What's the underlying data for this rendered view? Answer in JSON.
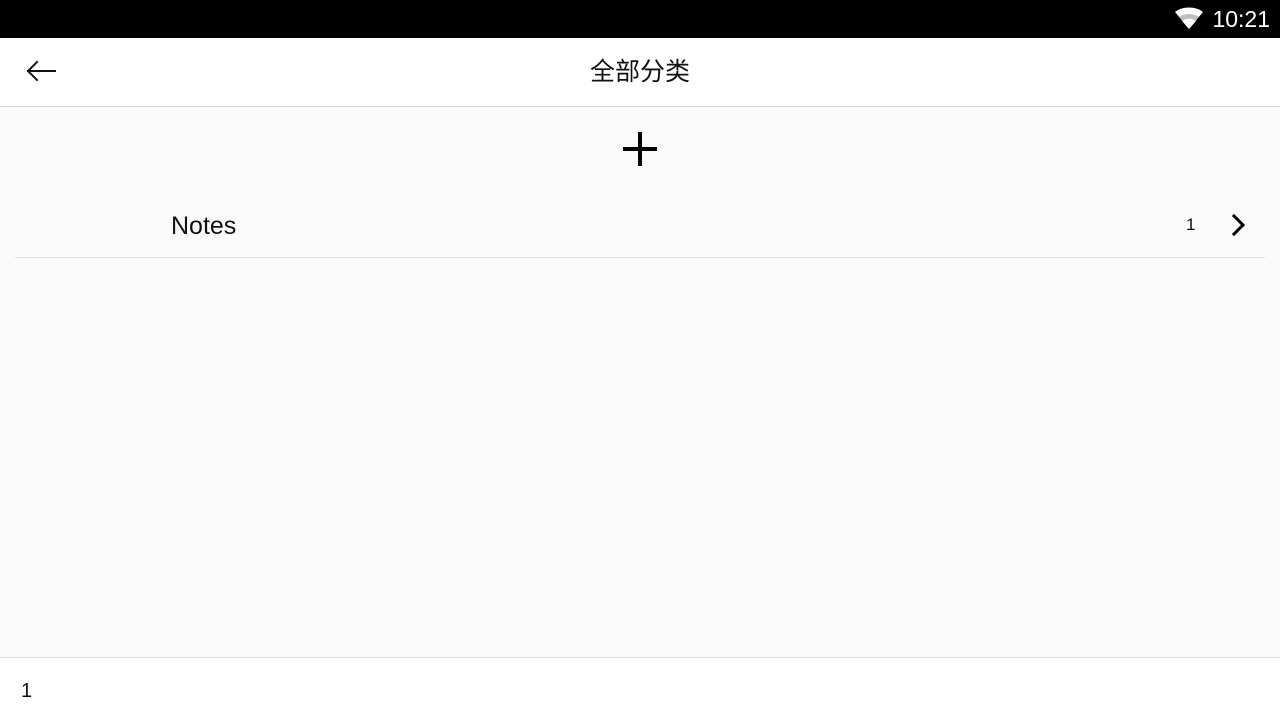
{
  "status_bar": {
    "time": "10:21",
    "wifi_icon": "wifi-icon"
  },
  "header": {
    "back_icon": "arrow-left-icon",
    "title": "全部分类"
  },
  "main": {
    "add_icon": "plus-icon",
    "categories": [
      {
        "name": "Notes",
        "count": "1",
        "arrow_icon": "chevron-right-icon"
      }
    ]
  },
  "footer": {
    "count": "1"
  },
  "colors": {
    "status_bar_background": "#000000",
    "app_bar_background": "#ffffff",
    "content_background": "#fafafa",
    "divider": "#d9d9d9",
    "text": "#111111"
  }
}
